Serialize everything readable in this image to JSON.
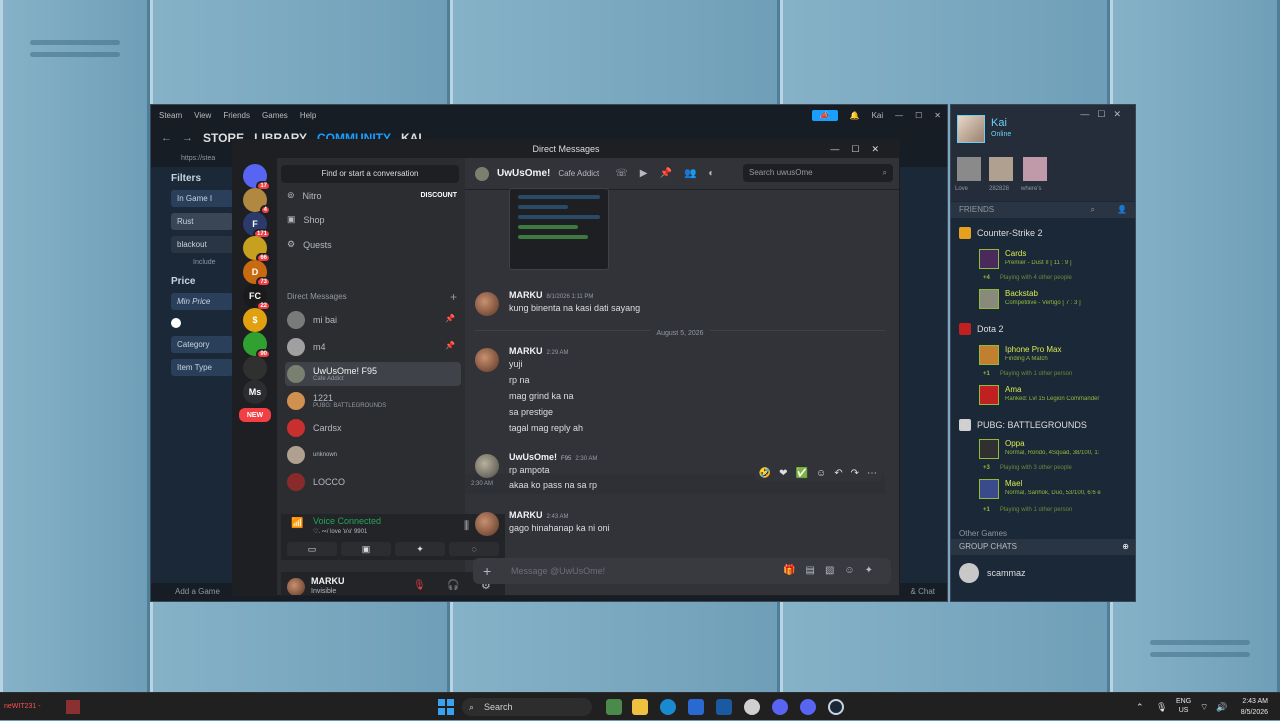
{
  "steam": {
    "menu": [
      "Steam",
      "View",
      "Friends",
      "Games",
      "Help"
    ],
    "user": "Kai",
    "tabs": [
      "STORE",
      "LIBRARY",
      "COMMUNITY",
      "KAI"
    ],
    "url": "https://stea",
    "filters": {
      "title": "Filters",
      "in_game": "In Game I",
      "rust": "Rust",
      "blackout": "blackout",
      "include": "Include",
      "price": "Price",
      "min_price": "Min Price",
      "category": "Category",
      "item_type": "Item Type"
    },
    "add_game": "Add a Game",
    "chat": "& Chat"
  },
  "discord": {
    "title": "Direct Messages",
    "find": "Find or start a conversation",
    "nav": {
      "nitro": "Nitro",
      "discount": "DISCOUNT",
      "shop": "Shop",
      "quests": "Quests"
    },
    "dm_header": "Direct Messages",
    "dms": [
      {
        "name": "mi bai",
        "sub": ""
      },
      {
        "name": "m4",
        "sub": ""
      },
      {
        "name": "UwUsOme!",
        "tag": "F95",
        "sub": "Cafe Addict"
      },
      {
        "name": "1221",
        "sub": "PUBG: BATTLEGROUNDS"
      },
      {
        "name": "Cardsx",
        "sub": ""
      },
      {
        "name": "unknown",
        "sub": ""
      },
      {
        "name": "LOCCO",
        "sub": ""
      }
    ],
    "servers": [
      {
        "label": "",
        "badge": "17",
        "color": "#5865f2"
      },
      {
        "label": "",
        "badge": "4",
        "color": "#b08840"
      },
      {
        "label": "F",
        "badge": "171",
        "color": "#2a3a6a"
      },
      {
        "label": "",
        "badge": "66",
        "color": "#c8a020"
      },
      {
        "label": "D",
        "badge": "73",
        "color": "#c86a10"
      },
      {
        "label": "FC",
        "badge": "22",
        "color": "#1a1a1a"
      },
      {
        "label": "$",
        "badge": "",
        "color": "#e0a010"
      },
      {
        "label": "",
        "badge": "90",
        "color": "#30a030"
      },
      {
        "label": "",
        "badge": "",
        "color": "#303030"
      },
      {
        "label": "Ms",
        "badge": "",
        "color": "#2b2d31"
      },
      {
        "label": "NEW",
        "badge": "",
        "color": "#f23f43"
      }
    ],
    "voice": {
      "status": "Voice Connected",
      "server": "♡. ∾/ love 'ʚ'ɞ' 9901"
    },
    "user": {
      "name": "MARKU",
      "status": "Invisible"
    },
    "chat": {
      "name": "UwUsOme!",
      "status": "Cafe Addict",
      "search_placeholder": "Search uwusOme",
      "composer_placeholder": "Message @UwUsOme!"
    },
    "messages": [
      {
        "author": "MARKU",
        "time": "8/1/2026 1:11 PM",
        "lines": [
          "kung binenta na kasi dati sayang"
        ]
      },
      {
        "divider": "August 5, 2026"
      },
      {
        "author": "MARKU",
        "time": "2:29 AM",
        "lines": [
          "yuji",
          "rp na",
          "mag grind ka na",
          "sa prestige",
          "tagal mag reply ah"
        ]
      },
      {
        "author": "UwUsOme!",
        "tag": "F95",
        "time": "2:30 AM",
        "lines": [
          "rp ampota"
        ],
        "hover_time": "2:30 AM",
        "hover_line": "akaa ko pass na sa rp"
      },
      {
        "author": "MARKU",
        "time": "2:43 AM",
        "lines": [
          "gago hinahanap ka ni oni"
        ]
      }
    ]
  },
  "friends": {
    "name": "Kai",
    "status": "Online",
    "recent_labels": [
      "Love",
      "282828",
      "where's"
    ],
    "header": "FRIENDS",
    "groups": [
      {
        "game": "Counter-Strike 2",
        "color": "#e8a020",
        "entries": [
          {
            "name": "Cards",
            "status": "Premier - Dust II [ 11 : 9 ]"
          },
          {
            "more": "+4",
            "text": "Playing with 4 other people"
          },
          {
            "name": "Backstab",
            "status": "Competitive - Vertigo [ 7 : 3 ]"
          }
        ]
      },
      {
        "game": "Dota 2",
        "color": "#c02020",
        "entries": [
          {
            "name": "Iphone Pro Max",
            "status": "Finding A Match"
          },
          {
            "more": "+1",
            "text": "Playing with 1 other person"
          },
          {
            "name": "Ama",
            "status": "Ranked: Lvl 15 Legion Commander"
          }
        ]
      },
      {
        "game": "PUBG: BATTLEGROUNDS",
        "color": "#d0d0d0",
        "entries": [
          {
            "name": "Oppa",
            "status": "Normal, Rondo, 4Squad, 38/100, 1:"
          },
          {
            "more": "+3",
            "text": "Playing with 3 other people"
          },
          {
            "name": "Mael",
            "status": "Normal, Sanhok, Duo, 53/100, 6:6 e"
          },
          {
            "more": "+1",
            "text": "Playing with 1 other person"
          }
        ]
      }
    ],
    "other_games": "Other Games",
    "group_chats": "GROUP CHATS",
    "group_chat_name": "scammaz"
  },
  "taskbar": {
    "search": "Search",
    "lang": "ENG",
    "region": "US",
    "time": "2:43 AM",
    "date": "8/5/2026",
    "left_label": "neWIT231 -"
  }
}
